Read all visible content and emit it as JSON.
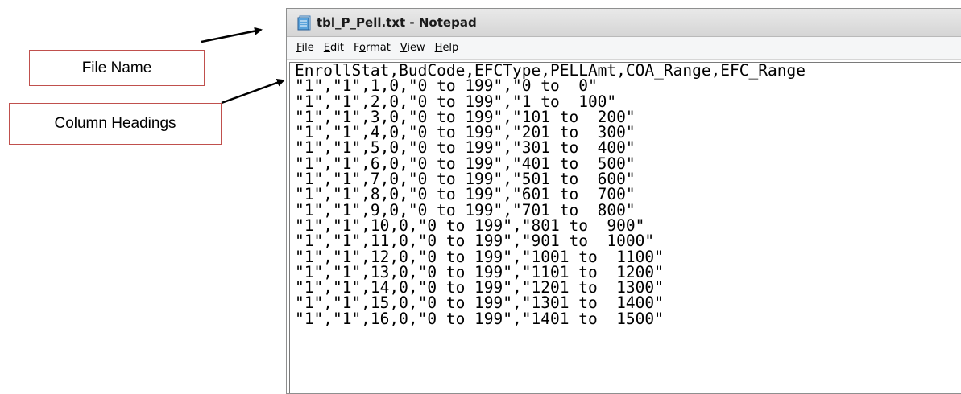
{
  "callouts": {
    "file_name": "File Name",
    "column_headings": "Column Headings"
  },
  "window": {
    "title": "tbl_P_Pell.txt - Notepad",
    "icon": "notepad-icon"
  },
  "menu": [
    {
      "mnemonic": "F",
      "rest": "ile"
    },
    {
      "mnemonic": "E",
      "rest": "dit"
    },
    {
      "mnemonic": "",
      "rest": "F",
      "mnemonic_mid": "o",
      "rest2": "rmat"
    },
    {
      "mnemonic": "V",
      "rest": "iew"
    },
    {
      "mnemonic": "H",
      "rest": "elp"
    }
  ],
  "menu_labels": [
    "File",
    "Edit",
    "Format",
    "View",
    "Help"
  ],
  "content": {
    "lines": [
      "EnrollStat,BudCode,EFCType,PELLAmt,COA_Range,EFC_Range",
      "\"1\",\"1\",1,0,\"0 to 199\",\"0 to  0\"",
      "\"1\",\"1\",2,0,\"0 to 199\",\"1 to  100\"",
      "\"1\",\"1\",3,0,\"0 to 199\",\"101 to  200\"",
      "\"1\",\"1\",4,0,\"0 to 199\",\"201 to  300\"",
      "\"1\",\"1\",5,0,\"0 to 199\",\"301 to  400\"",
      "\"1\",\"1\",6,0,\"0 to 199\",\"401 to  500\"",
      "\"1\",\"1\",7,0,\"0 to 199\",\"501 to  600\"",
      "\"1\",\"1\",8,0,\"0 to 199\",\"601 to  700\"",
      "\"1\",\"1\",9,0,\"0 to 199\",\"701 to  800\"",
      "\"1\",\"1\",10,0,\"0 to 199\",\"801 to  900\"",
      "\"1\",\"1\",11,0,\"0 to 199\",\"901 to  1000\"",
      "\"1\",\"1\",12,0,\"0 to 199\",\"1001 to  1100\"",
      "\"1\",\"1\",13,0,\"0 to 199\",\"1101 to  1200\"",
      "\"1\",\"1\",14,0,\"0 to 199\",\"1201 to  1300\"",
      "\"1\",\"1\",15,0,\"0 to 199\",\"1301 to  1400\"",
      "\"1\",\"1\",16,0,\"0 to 199\",\"1401 to  1500\""
    ]
  },
  "colors": {
    "callout_border": "#c0504d",
    "arrow": "#000000"
  }
}
